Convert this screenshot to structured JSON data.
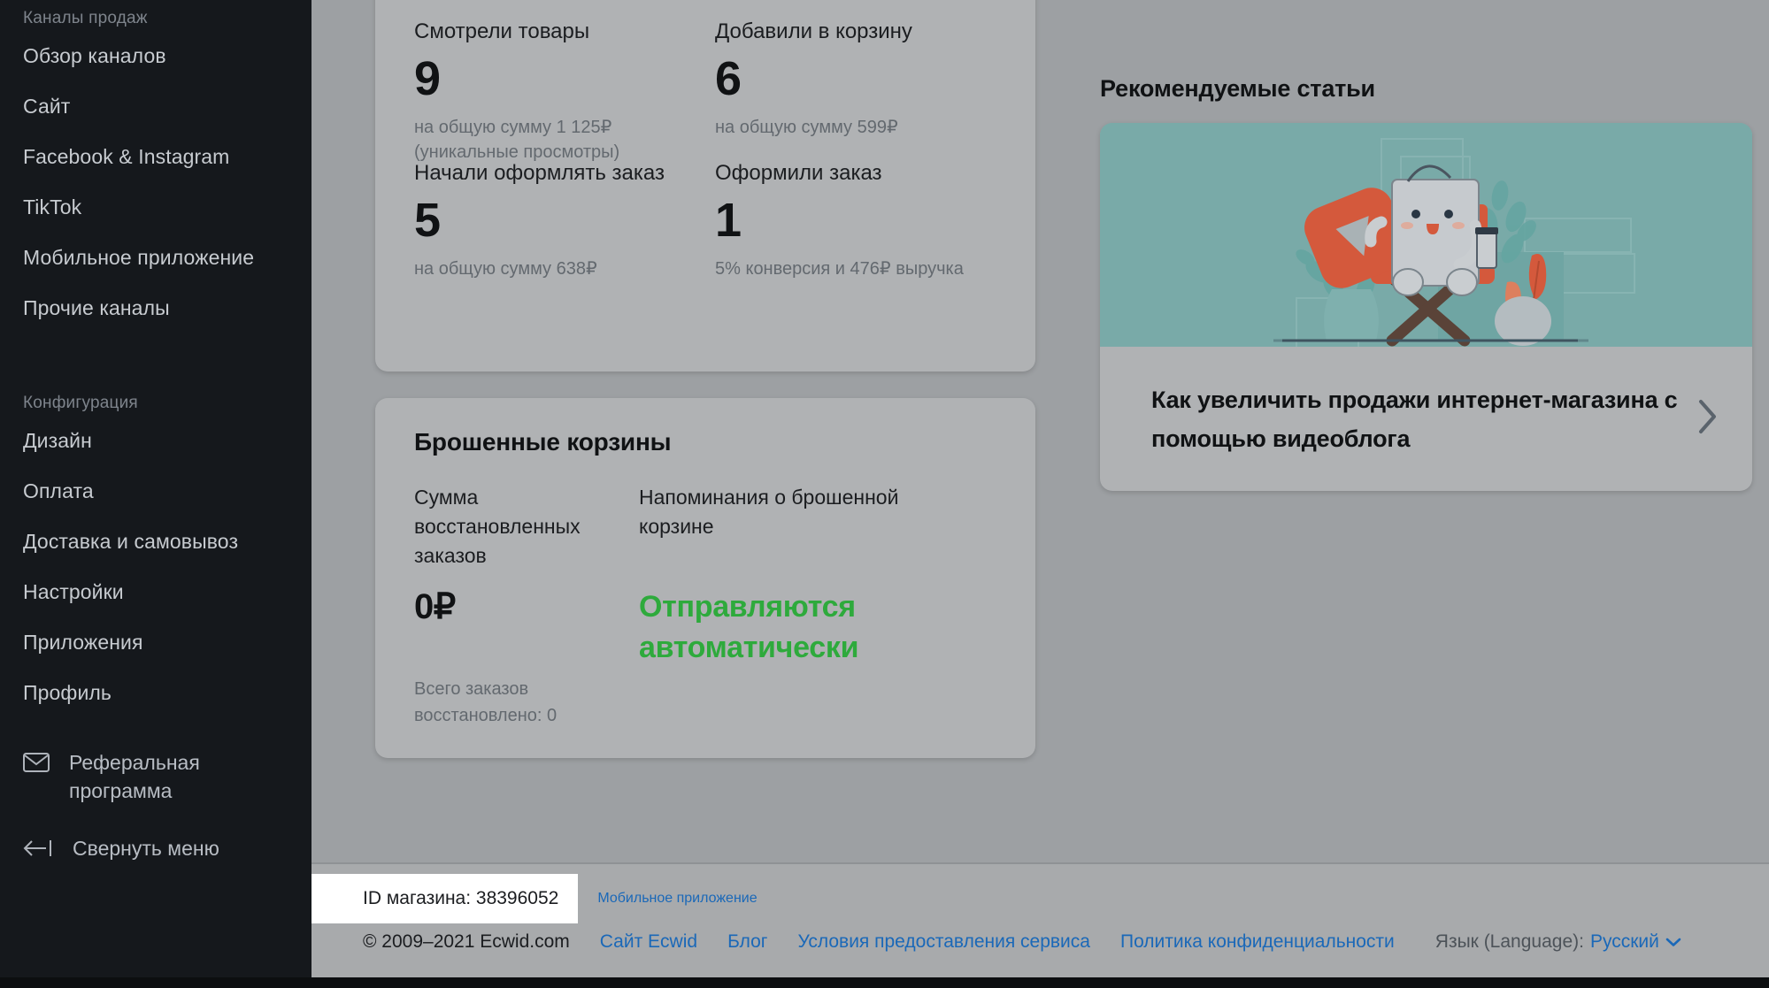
{
  "sidebar": {
    "groups": [
      {
        "title": "Каналы продаж",
        "items": [
          {
            "label": "Обзор каналов"
          },
          {
            "label": "Сайт"
          },
          {
            "label": "Facebook & Instagram"
          },
          {
            "label": "TikTok"
          },
          {
            "label": "Мобильное приложение"
          },
          {
            "label": "Прочие каналы"
          }
        ]
      },
      {
        "title": "Конфигурация",
        "items": [
          {
            "label": "Дизайн"
          },
          {
            "label": "Оплата"
          },
          {
            "label": "Доставка и самовывоз"
          },
          {
            "label": "Настройки"
          },
          {
            "label": "Приложения"
          },
          {
            "label": "Профиль"
          }
        ]
      }
    ],
    "bottom": [
      {
        "label": "Реферальная программа",
        "icon": "envelope-icon"
      },
      {
        "label": "Свернуть меню",
        "icon": "collapse-arrow-icon"
      }
    ]
  },
  "stats": {
    "items": [
      {
        "label": "Смотрели товары",
        "value": "9",
        "sub": "на общую сумму 1 125₽ (уникальные просмотры)"
      },
      {
        "label": "Добавили в корзину",
        "value": "6",
        "sub": "на общую сумму 599₽"
      },
      {
        "label": "Начали оформлять заказ",
        "value": "5",
        "sub": "на общую сумму 638₽"
      },
      {
        "label": "Оформили заказ",
        "value": "1",
        "sub": "5% конверсия и 476₽ выручка"
      }
    ]
  },
  "carts": {
    "title": "Брошенные корзины",
    "recovered_label": "Сумма восстановленных заказов",
    "recovered_amount": "0₽",
    "total_recovered": "Всего заказов восстановлено: 0",
    "reminders_label": "Напоминания о брошенной корзине",
    "reminders_status": "Отправляются автоматически",
    "status_color": "#2eaa3c"
  },
  "articles": {
    "section_title": "Рекомендуемые статьи",
    "card": {
      "title": "Как увеличить продажи интернет-магазина с помощью видеоблога",
      "hero_bg": "#79aaa8",
      "chevron": "chevron-right-icon"
    }
  },
  "footer": {
    "store_id": "ID магазина: 38396052",
    "mobile_app_link": "Мобильное приложение",
    "copyright": "© 2009–2021 Ecwid.com",
    "links": [
      "Сайт Ecwid",
      "Блог",
      "Условия предоставления сервиса",
      "Политика конфиденциальности"
    ],
    "language_label": "Язык (Language):",
    "language_value": "Русский"
  }
}
